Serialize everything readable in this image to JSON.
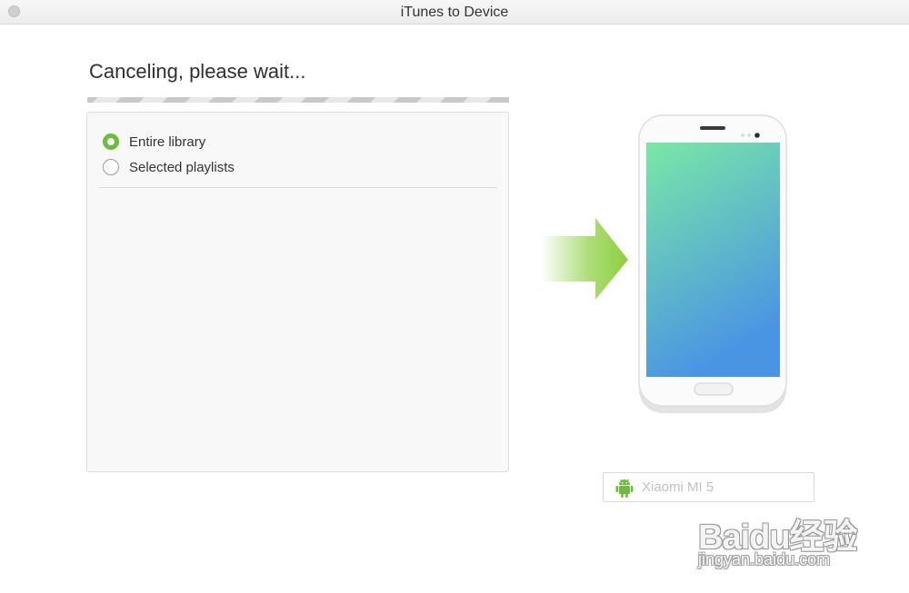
{
  "window": {
    "title": "iTunes to Device"
  },
  "status": {
    "title": "Canceling, please wait..."
  },
  "options": [
    {
      "label": "Entire library",
      "checked": true
    },
    {
      "label": "Selected playlists",
      "checked": false
    }
  ],
  "device": {
    "name": "Xiaomi MI 5",
    "platform_icon": "android-icon"
  },
  "watermark": {
    "main": "Baidu经验",
    "sub": "jingyan.baidu.com"
  },
  "colors": {
    "accent": "#6cbd3c",
    "arrow": "#8ccf3f",
    "screen_top": "#79e8a6",
    "screen_bottom": "#4a94e4"
  }
}
